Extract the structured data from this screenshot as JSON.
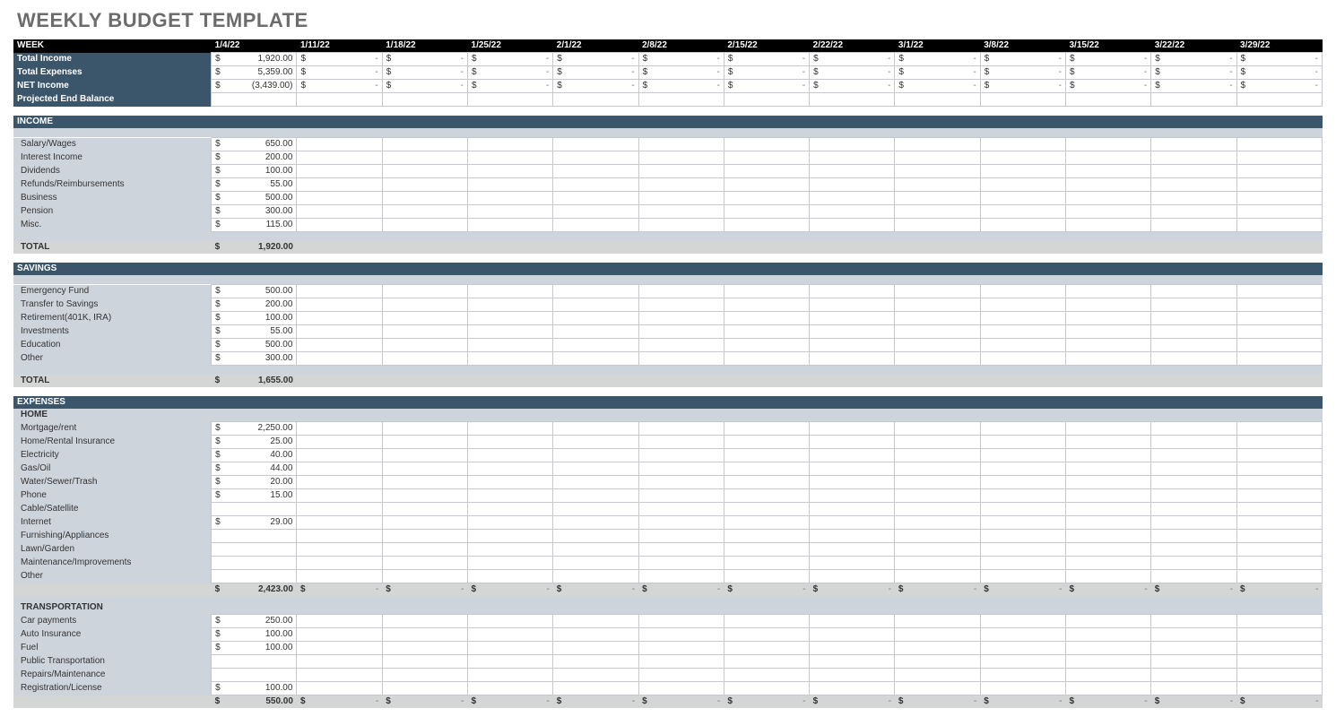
{
  "title": "WEEKLY BUDGET TEMPLATE",
  "weeks": [
    "1/4/22",
    "1/11/22",
    "1/18/22",
    "1/25/22",
    "2/1/22",
    "2/8/22",
    "2/15/22",
    "2/22/22",
    "3/1/22",
    "3/8/22",
    "3/15/22",
    "3/22/22",
    "3/29/22"
  ],
  "summary": {
    "week_label": "WEEK",
    "rows": [
      {
        "label": "Total Income",
        "first": "1,920.00"
      },
      {
        "label": "Total Expenses",
        "first": "5,359.00"
      },
      {
        "label": "NET Income",
        "first": "(3,439.00)"
      },
      {
        "label": "Projected End Balance",
        "first": ""
      }
    ]
  },
  "sections": [
    {
      "name": "INCOME",
      "items": [
        {
          "label": "Salary/Wages",
          "first": "650.00"
        },
        {
          "label": "Interest Income",
          "first": "200.00"
        },
        {
          "label": "Dividends",
          "first": "100.00"
        },
        {
          "label": "Refunds/Reimbursements",
          "first": "55.00"
        },
        {
          "label": "Business",
          "first": "500.00"
        },
        {
          "label": "Pension",
          "first": "300.00"
        },
        {
          "label": "Misc.",
          "first": "115.00"
        }
      ],
      "total_label": "TOTAL",
      "total_first": "1,920.00",
      "total_others_dashed": false
    },
    {
      "name": "SAVINGS",
      "items": [
        {
          "label": "Emergency Fund",
          "first": "500.00"
        },
        {
          "label": "Transfer to Savings",
          "first": "200.00"
        },
        {
          "label": "Retirement(401K, IRA)",
          "first": "100.00"
        },
        {
          "label": "Investments",
          "first": "55.00"
        },
        {
          "label": "Education",
          "first": "500.00"
        },
        {
          "label": "Other",
          "first": "300.00"
        }
      ],
      "total_label": "TOTAL",
      "total_first": "1,655.00",
      "total_others_dashed": false
    }
  ],
  "expenses": {
    "name": "EXPENSES",
    "groups": [
      {
        "name": "HOME",
        "items": [
          {
            "label": "Mortgage/rent",
            "first": "2,250.00"
          },
          {
            "label": "Home/Rental Insurance",
            "first": "25.00"
          },
          {
            "label": "Electricity",
            "first": "40.00"
          },
          {
            "label": "Gas/Oil",
            "first": "44.00"
          },
          {
            "label": "Water/Sewer/Trash",
            "first": "20.00"
          },
          {
            "label": "Phone",
            "first": "15.00"
          },
          {
            "label": "Cable/Satellite",
            "first": ""
          },
          {
            "label": "Internet",
            "first": "29.00"
          },
          {
            "label": "Furnishing/Appliances",
            "first": ""
          },
          {
            "label": "Lawn/Garden",
            "first": ""
          },
          {
            "label": "Maintenance/Improvements",
            "first": ""
          },
          {
            "label": "Other",
            "first": ""
          }
        ],
        "subtotal_first": "2,423.00",
        "subtotal_others_dashed": true
      },
      {
        "name": "TRANSPORTATION",
        "items": [
          {
            "label": "Car payments",
            "first": "250.00"
          },
          {
            "label": "Auto Insurance",
            "first": "100.00"
          },
          {
            "label": "Fuel",
            "first": "100.00"
          },
          {
            "label": "Public Transportation",
            "first": ""
          },
          {
            "label": "Repairs/Maintenance",
            "first": ""
          },
          {
            "label": "Registration/License",
            "first": "100.00"
          }
        ],
        "subtotal_first": "550.00",
        "subtotal_others_dashed": true
      }
    ]
  }
}
